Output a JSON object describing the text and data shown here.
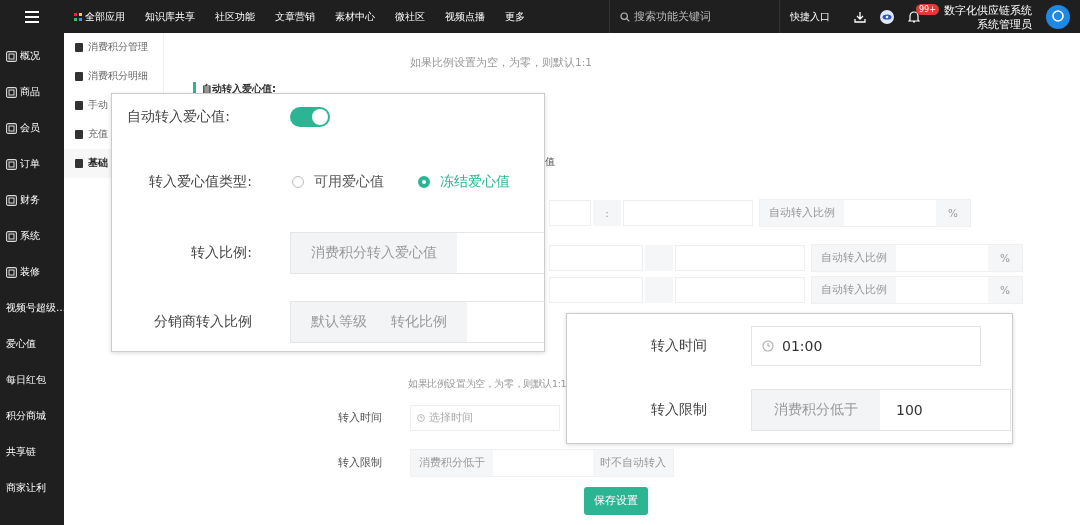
{
  "top_bar": {
    "nav": [
      {
        "label": "全部应用",
        "kind": "apps"
      },
      {
        "label": "知识库共享",
        "kind": "plain"
      },
      {
        "label": "社区功能",
        "kind": "plain"
      },
      {
        "label": "文章营销",
        "kind": "plain"
      },
      {
        "label": "素材中心",
        "kind": "plain"
      },
      {
        "label": "微社区",
        "kind": "plain"
      },
      {
        "label": "视频点播",
        "kind": "plain"
      },
      {
        "label": "更多",
        "kind": "plain"
      }
    ],
    "search": {
      "placeholder": "搜索功能关键词"
    },
    "quick_entry": "快捷入口",
    "notification_badge": "99+",
    "org_name": "数字化供应链系统",
    "user_role": "系统管理员"
  },
  "sidebar": {
    "items": [
      {
        "label": "概况",
        "kind": "icon"
      },
      {
        "label": "商品",
        "kind": "icon"
      },
      {
        "label": "会员",
        "kind": "icon"
      },
      {
        "label": "订单",
        "kind": "icon"
      },
      {
        "label": "财务",
        "kind": "icon"
      },
      {
        "label": "系统",
        "kind": "icon"
      },
      {
        "label": "装修",
        "kind": "icon"
      },
      {
        "label": "视频号超级…",
        "kind": "plain"
      },
      {
        "label": "爱心值",
        "kind": "plain"
      },
      {
        "label": "每日红包",
        "kind": "plain"
      },
      {
        "label": "积分商城",
        "kind": "plain"
      },
      {
        "label": "共享链",
        "kind": "plain"
      },
      {
        "label": "商家让利",
        "kind": "plain"
      }
    ]
  },
  "submenu": {
    "items": [
      {
        "label": "消费积分管理",
        "selected": false
      },
      {
        "label": "消费积分明细",
        "selected": false
      },
      {
        "label": "手动",
        "selected": false
      },
      {
        "label": "充值",
        "selected": false
      },
      {
        "label": "基础",
        "selected": true
      }
    ]
  },
  "form": {
    "hint_top": "如果比例设置为空，为零，则默认1:1",
    "section_title": "自动转入爱心值:",
    "type_label_tail": "值",
    "ratio_rows": [
      {
        "separator": ":",
        "label": "自动转入比例",
        "unit": "%"
      },
      {
        "separator": "",
        "label": "自动转入比例",
        "unit": "%"
      },
      {
        "separator": "",
        "label": "自动转入比例",
        "unit": "%"
      }
    ],
    "hint_bottom": "如果比例设置为空，为零，则默认1:1",
    "time": {
      "label": "转入时间",
      "placeholder": "选择时间"
    },
    "limit": {
      "label": "转入限制",
      "prefix": "消费积分低于",
      "suffix": "时不自动转入"
    },
    "save_button": "保存设置"
  },
  "callout_settings": {
    "auto_label": "自动转入爱心值:",
    "auto_on": true,
    "type_label": "转入爱心值类型:",
    "type_options": [
      {
        "label": "可用爱心值",
        "selected": false
      },
      {
        "label": "冻结爱心值",
        "selected": true
      }
    ],
    "ratio_label": "转入比例:",
    "ratio_prefix": "消费积分转入爱心值",
    "dist_label": "分销商转入比例",
    "dist_level": "默认等级",
    "dist_ratio": "转化比例"
  },
  "callout_time": {
    "time_label": "转入时间",
    "time_value": "01:00",
    "limit_label": "转入限制",
    "limit_prefix": "消费积分低于",
    "limit_value": "100"
  }
}
